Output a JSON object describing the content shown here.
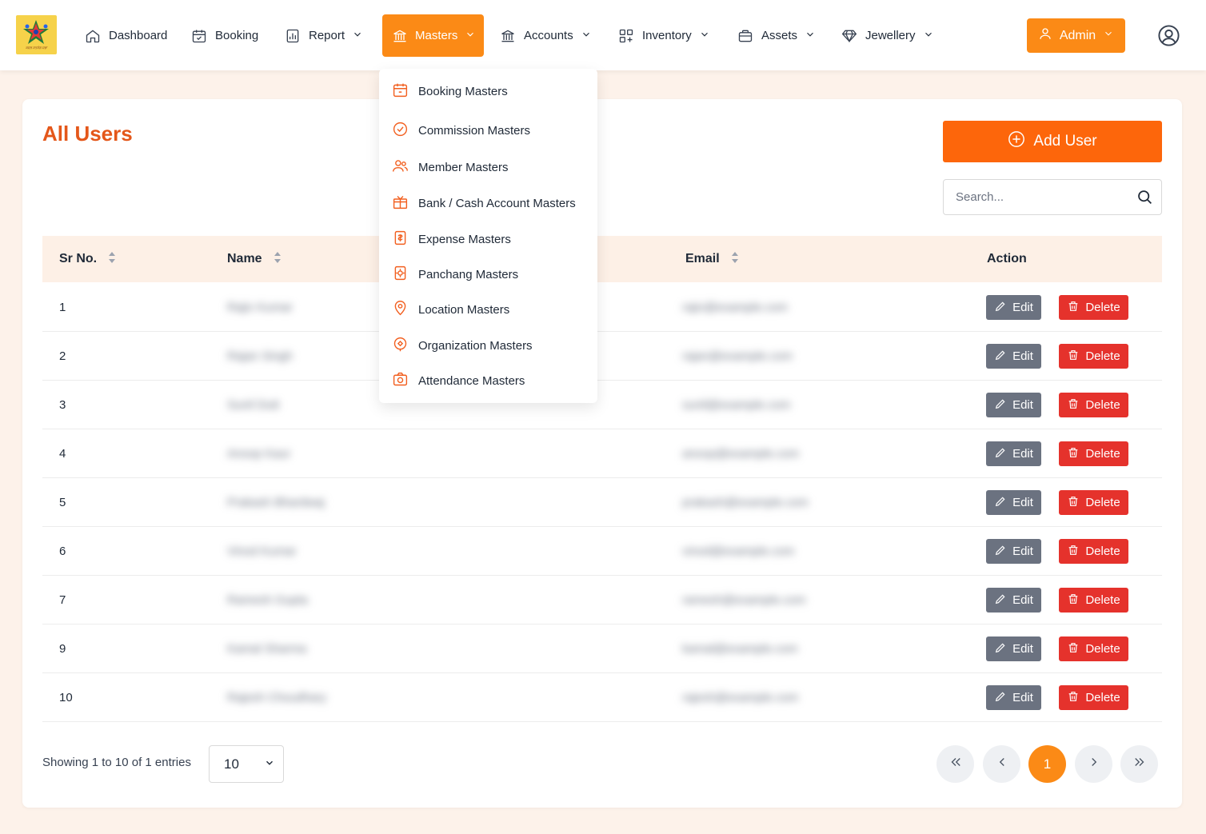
{
  "nav": {
    "logo_text": "ਕਵਲ ਸਤਸੰਗ ਸਭਾ",
    "items": [
      {
        "label": "Dashboard",
        "icon": "home-icon",
        "dropdown": false
      },
      {
        "label": "Booking",
        "icon": "calendar-icon",
        "dropdown": false
      },
      {
        "label": "Report",
        "icon": "report-icon",
        "dropdown": true
      },
      {
        "label": "Masters",
        "icon": "bank-icon",
        "dropdown": true,
        "active": true
      },
      {
        "label": "Accounts",
        "icon": "bank-icon",
        "dropdown": true
      },
      {
        "label": "Inventory",
        "icon": "grid-icon",
        "dropdown": true
      },
      {
        "label": "Assets",
        "icon": "briefcase-icon",
        "dropdown": true
      },
      {
        "label": "Jewellery",
        "icon": "diamond-icon",
        "dropdown": true
      }
    ],
    "admin_label": "Admin",
    "accent_color": "#fb8a16"
  },
  "masters_menu": [
    {
      "label": "Booking Masters",
      "icon": "calendar-icon"
    },
    {
      "label": "Commission Masters",
      "icon": "check-circle-icon"
    },
    {
      "label": "Member Masters",
      "icon": "users-icon"
    },
    {
      "label": "Bank / Cash Account Masters",
      "icon": "gift-bank-icon"
    },
    {
      "label": "Expense Masters",
      "icon": "receipt-icon"
    },
    {
      "label": "Panchang Masters",
      "icon": "panchang-icon"
    },
    {
      "label": "Location Masters",
      "icon": "location-icon"
    },
    {
      "label": "Organization Masters",
      "icon": "organization-icon"
    },
    {
      "label": "Attendance Masters",
      "icon": "camera-icon"
    }
  ],
  "page": {
    "title": "All Users",
    "add_user_label": "Add User",
    "search_placeholder": "Search...",
    "title_color": "#e4571a",
    "add_button_color": "#fd660b"
  },
  "table": {
    "columns": [
      "Sr No.",
      "Name",
      "Email",
      "Action"
    ],
    "edit_label": "Edit",
    "delete_label": "Delete",
    "rows": [
      {
        "sr": "1",
        "name": "Rajiv Kumar",
        "email": "rajiv@example.com"
      },
      {
        "sr": "2",
        "name": "Rajan Singh",
        "email": "rajan@example.com"
      },
      {
        "sr": "3",
        "name": "Sunil Dutt",
        "email": "sunil@example.com"
      },
      {
        "sr": "4",
        "name": "Anoop Kaur",
        "email": "anoop@example.com"
      },
      {
        "sr": "5",
        "name": "Prakash Bhardwaj",
        "email": "prakash@example.com"
      },
      {
        "sr": "6",
        "name": "Vinod Kumar",
        "email": "vinod@example.com"
      },
      {
        "sr": "7",
        "name": "Ramesh Gupta",
        "email": "ramesh@example.com"
      },
      {
        "sr": "9",
        "name": "Kamal Sharma",
        "email": "kamal@example.com"
      },
      {
        "sr": "10",
        "name": "Rajesh Choudhary",
        "email": "rajesh@example.com"
      }
    ]
  },
  "footer": {
    "showing_text": "Showing 1 to 10 of 1 entries",
    "page_size": "10",
    "current_page": "1"
  }
}
